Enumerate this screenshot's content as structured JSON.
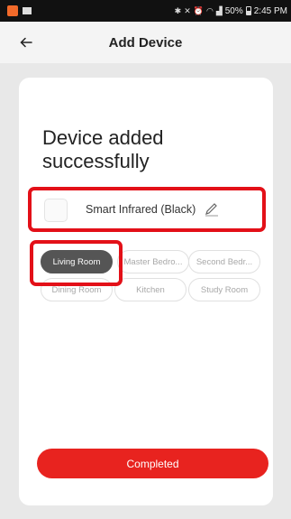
{
  "statusbar": {
    "battery": "50%",
    "time": "2:45 PM"
  },
  "header": {
    "back_icon": "arrow-left-icon",
    "title": "Add Device"
  },
  "main": {
    "heading": "Device added successfully",
    "device": {
      "name": "Smart Infrared (Black)",
      "edit_icon": "pencil-icon"
    },
    "rooms": [
      {
        "label": "Living Room",
        "selected": true
      },
      {
        "label": "Master Bedro...",
        "selected": false
      },
      {
        "label": "Second Bedr...",
        "selected": false
      },
      {
        "label": "Dining Room",
        "selected": false
      },
      {
        "label": "Kitchen",
        "selected": false
      },
      {
        "label": "Study Room",
        "selected": false
      }
    ],
    "completed_label": "Completed"
  },
  "colors": {
    "accent": "#e8231f",
    "highlight_border": "#e31018",
    "selected_room": "#555555"
  }
}
